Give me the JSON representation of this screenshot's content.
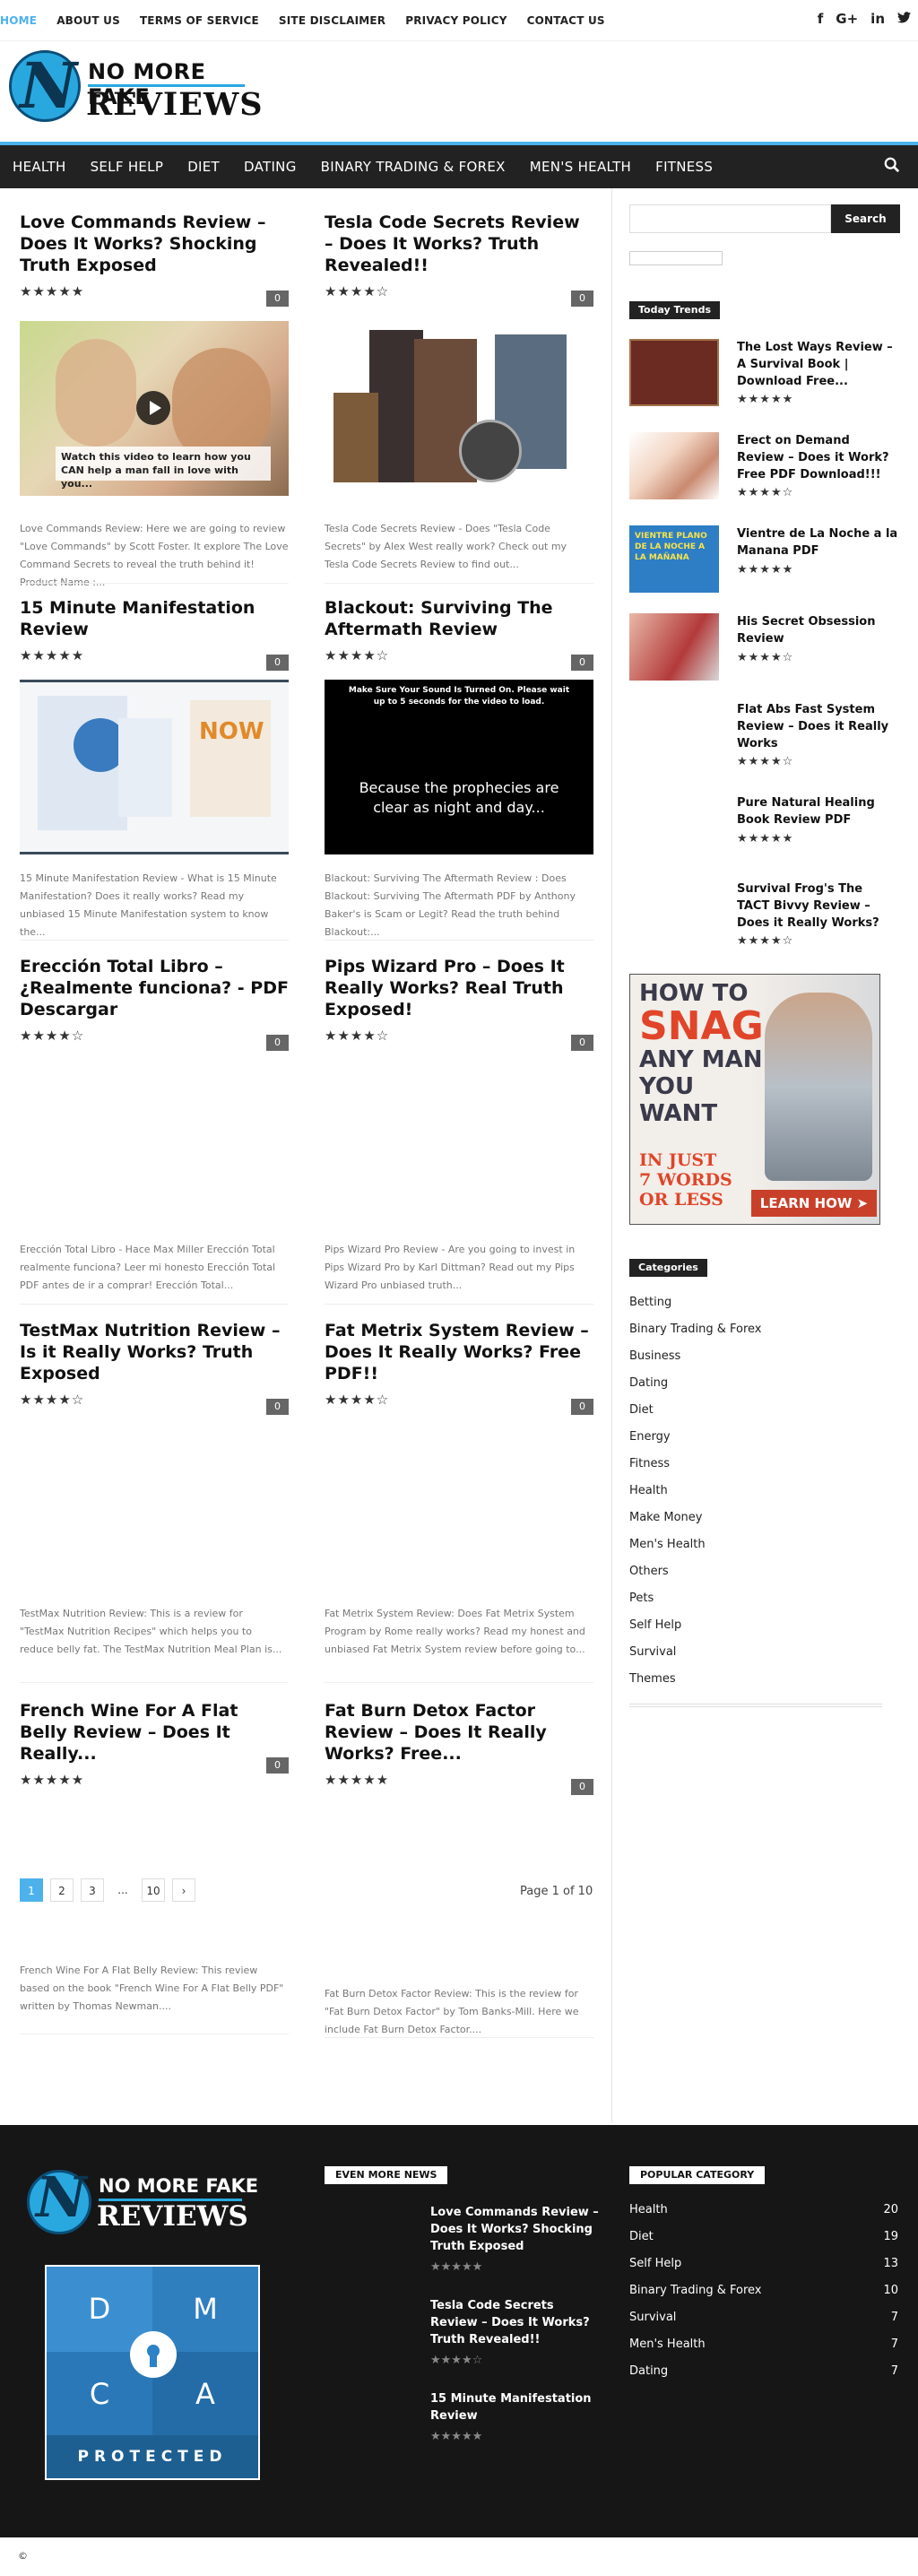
{
  "topmenu": [
    "HOME",
    "ABOUT US",
    "TERMS OF SERVICE",
    "SITE DISCLAIMER",
    "PRIVACY POLICY",
    "CONTACT US"
  ],
  "social_icons": [
    "facebook-icon",
    "google-plus-icon",
    "linkedin-icon",
    "twitter-icon"
  ],
  "logo": {
    "line1": "NO MORE FAKE",
    "line2": "REVIEWS"
  },
  "nav": [
    "HEALTH",
    "SELF HELP",
    "DIET",
    "DATING",
    "BINARY TRADING & FOREX",
    "MEN'S HEALTH",
    "FITNESS"
  ],
  "posts": [
    {
      "title": "Love Commands Review – Does It Works? Shocking Truth Exposed",
      "stars": "★★★★★",
      "comments": "0",
      "excerpt": "Love Commands Review: Here we are going to review \"Love Commands\" by Scott Foster. It explore The Love Command Secrets to reveal the truth behind it! Product Name :...",
      "img_caption": "Watch this video to learn how you CAN help a man fall in love with you..."
    },
    {
      "title": "Tesla Code Secrets Review – Does It Works? Truth Revealed!!",
      "stars": "★★★★☆",
      "comments": "0",
      "excerpt": "Tesla Code Secrets Review - Does \"Tesla Code Secrets\" by Alex West really work? Check out my Tesla Code Secrets Review to find out..."
    },
    {
      "title": "15 Minute Manifestation Review",
      "stars": "★★★★★",
      "comments": "0",
      "excerpt": "15 Minute Manifestation Review - What is 15 Minute Manifestation? Does it really works? Read my unbiased 15 Minute Manifestation system to know the..."
    },
    {
      "title": "Blackout: Surviving The Aftermath Review",
      "stars": "★★★★☆",
      "comments": "0",
      "excerpt": "Blackout: Surviving The Aftermath Review : Does Blackout: Surviving The Aftermath PDF by Anthony Baker's is Scam or Legit? Read the truth behind Blackout:...",
      "img_top": "Make Sure Your Sound Is Turned On. Please wait up to 5 seconds for the video to load.",
      "img_main": "Because the prophecies are clear as night and day..."
    },
    {
      "title": "Erección Total Libro – ¿Realmente funciona? - PDF Descargar",
      "stars": "★★★★☆",
      "comments": "0",
      "excerpt": "Erección Total Libro - Hace Max Miller Erección Total realmente funciona? Leer mi honesto Erección Total PDF antes de ir a comprar! Erección Total..."
    },
    {
      "title": "Pips Wizard Pro – Does It Really Works? Real Truth Exposed!",
      "stars": "★★★★☆",
      "comments": "0",
      "excerpt": "Pips Wizard Pro Review - Are you going to invest in Pips Wizard Pro by Karl Dittman? Read out my Pips Wizard Pro unbiased truth..."
    },
    {
      "title": "TestMax Nutrition Review – Is it Really Works? Truth Exposed",
      "stars": "★★★★☆",
      "comments": "0",
      "excerpt": "TestMax Nutrition Review: This is a review for \"TestMax Nutrition Recipes\" which helps you to reduce belly fat. The TestMax Nutrition Meal Plan is..."
    },
    {
      "title": "Fat Metrix System Review – Does It Really Works? Free PDF!!",
      "stars": "★★★★☆",
      "comments": "0",
      "excerpt": "Fat Metrix System Review: Does Fat Metrix System Program by Rome really works? Read my honest and unbiased Fat Metrix System review before going to..."
    },
    {
      "title": "French Wine For A Flat Belly Review – Does It Really...",
      "stars": "★★★★★",
      "comments": "0",
      "excerpt": "French Wine For A Flat Belly Review: This review based on the book \"French Wine For A Flat Belly PDF\" written by Thomas Newman...."
    },
    {
      "title": "Fat Burn Detox Factor Review – Does It Really Works? Free...",
      "stars": "★★★★★",
      "comments": "0",
      "excerpt": "Fat Burn Detox Factor Review: This is the review for \"Fat Burn Detox Factor\" by Tom Banks-Mill. Here we include Fat Burn Detox Factor...."
    }
  ],
  "pagination": {
    "pages": [
      "1",
      "2",
      "3",
      "...",
      "10"
    ],
    "next": "›",
    "label": "Page 1 of 10"
  },
  "sidebar": {
    "search_button": "Search",
    "trends_title": "Today Trends",
    "trends": [
      {
        "title": "The Lost Ways Review – A Survival Book | Download Free...",
        "stars": "★★★★★"
      },
      {
        "title": "Erect on Demand Review – Does it Work? Free PDF Download!!!",
        "stars": "★★★★☆"
      },
      {
        "title": "Vientre de La Noche a la Manana PDF",
        "stars": "★★★★★",
        "img_text": "VIENTRE PLANO DE LA NOCHE A LA MAÑANA"
      },
      {
        "title": "His Secret Obsession Review",
        "stars": "★★★★☆"
      },
      {
        "title": "Flat Abs Fast System Review – Does it Really Works",
        "stars": "★★★★☆"
      },
      {
        "title": "Pure Natural Healing Book Review PDF",
        "stars": "★★★★★"
      },
      {
        "title": "Survival Frog's The TACT Bivvy Review – Does it Really Works?",
        "stars": "★★★★☆"
      }
    ],
    "ad": {
      "l1": "HOW TO",
      "l2": "SNAG",
      "l3": "ANY MAN",
      "l4": "YOU",
      "l5": "WANT",
      "l6": "IN JUST",
      "l7": "7 WORDS",
      "l8": "OR LESS",
      "cta": "LEARN HOW ➤"
    },
    "categories_title": "Categories",
    "categories": [
      "Betting",
      "Binary Trading & Forex",
      "Business",
      "Dating",
      "Diet",
      "Energy",
      "Fitness",
      "Health",
      "Make Money",
      "Men's Health",
      "Others",
      "Pets",
      "Self Help",
      "Survival",
      "Themes"
    ]
  },
  "footer": {
    "logo": {
      "line1": "NO MORE FAKE",
      "line2": "REVIEWS"
    },
    "dmca": {
      "d": "D",
      "m": "M",
      "c": "C",
      "a": "A",
      "bar": "PROTECTED"
    },
    "news_title": "EVEN MORE NEWS",
    "news": [
      {
        "title": "Love Commands Review – Does It Works? Shocking Truth Exposed",
        "stars": "★★★★★"
      },
      {
        "title": "Tesla Code Secrets Review – Does It Works? Truth Revealed!!",
        "stars": "★★★★☆"
      },
      {
        "title": "15 Minute Manifestation Review",
        "stars": "★★★★★"
      }
    ],
    "popular_title": "POPULAR CATEGORY",
    "popular": [
      {
        "name": "Health",
        "count": "20"
      },
      {
        "name": "Diet",
        "count": "19"
      },
      {
        "name": "Self Help",
        "count": "13"
      },
      {
        "name": "Binary Trading & Forex",
        "count": "10"
      },
      {
        "name": "Survival",
        "count": "7"
      },
      {
        "name": "Men's Health",
        "count": "7"
      },
      {
        "name": "Dating",
        "count": "7"
      }
    ],
    "copyright": "©"
  },
  "colors": {
    "accent": "#4db2ec",
    "nav_bg": "#222222",
    "footer_bg": "#161616"
  }
}
